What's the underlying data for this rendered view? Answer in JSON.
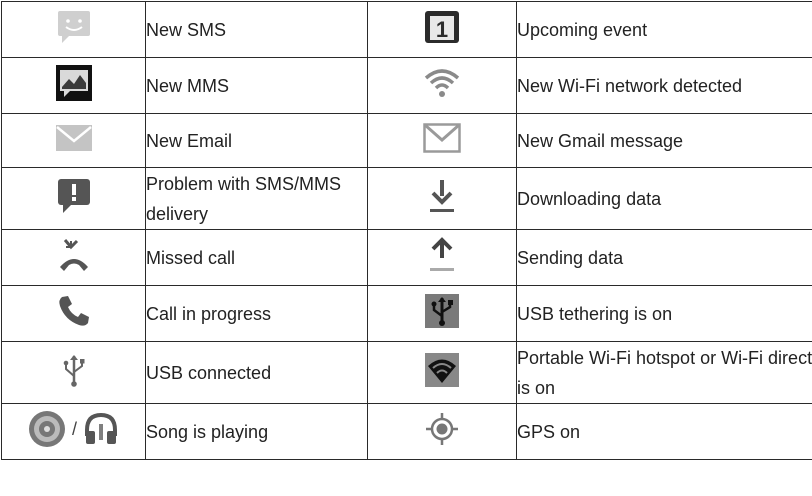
{
  "rows": [
    {
      "left": {
        "icon": "sms-icon",
        "label": "New SMS"
      },
      "right": {
        "icon": "calendar-icon",
        "label": "Upcoming event",
        "badge": "1"
      }
    },
    {
      "left": {
        "icon": "mms-icon",
        "label": "New MMS"
      },
      "right": {
        "icon": "wifi-network-icon",
        "label": "New Wi-Fi network detected"
      }
    },
    {
      "left": {
        "icon": "email-icon",
        "label": "New Email"
      },
      "right": {
        "icon": "gmail-icon",
        "label": "New Gmail message"
      }
    },
    {
      "left": {
        "icon": "sms-problem-icon",
        "label": "Problem with SMS/MMS delivery"
      },
      "right": {
        "icon": "download-icon",
        "label": "Downloading data"
      }
    },
    {
      "left": {
        "icon": "missed-call-icon",
        "label": "Missed call"
      },
      "right": {
        "icon": "upload-icon",
        "label": "Sending data"
      }
    },
    {
      "left": {
        "icon": "call-icon",
        "label": "Call in progress"
      },
      "right": {
        "icon": "usb-tethering-icon",
        "label": "USB tethering is on"
      }
    },
    {
      "left": {
        "icon": "usb-icon",
        "label": "USB connected"
      },
      "right": {
        "icon": "hotspot-icon",
        "label": "Portable Wi-Fi hotspot or Wi-Fi direct is on"
      }
    },
    {
      "left": {
        "icon": "music-icon",
        "label": "Song is playing",
        "separator": "/"
      },
      "right": {
        "icon": "gps-icon",
        "label": "GPS on"
      }
    }
  ]
}
